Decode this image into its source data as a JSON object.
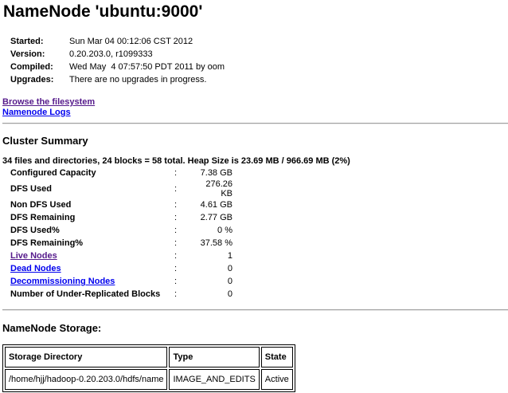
{
  "page": {
    "title": "NameNode 'ubuntu:9000'"
  },
  "info": [
    {
      "label": "Started:",
      "value": "Sun Mar 04 00:12:06 CST 2012"
    },
    {
      "label": "Version:",
      "value": "0.20.203.0, r1099333"
    },
    {
      "label": "Compiled:",
      "value": "Wed May  4 07:57:50 PDT 2011 by oom"
    },
    {
      "label": "Upgrades:",
      "value": "There are no upgrades in progress."
    }
  ],
  "links": {
    "browse": "Browse the filesystem",
    "logs": "Namenode Logs"
  },
  "cluster": {
    "heading": "Cluster Summary",
    "summary": "34 files and directories, 24 blocks = 58 total. Heap Size is 23.69 MB / 966.69 MB (2%)",
    "rows": [
      {
        "label": "Configured Capacity",
        "value": "7.38 GB"
      },
      {
        "label": "DFS Used",
        "value": "276.26 KB"
      },
      {
        "label": "Non DFS Used",
        "value": "4.61 GB"
      },
      {
        "label": "DFS Remaining",
        "value": "2.77 GB"
      },
      {
        "label": "DFS Used%",
        "value": "0 %"
      },
      {
        "label": "DFS Remaining%",
        "value": "37.58 %"
      },
      {
        "label": "Live Nodes",
        "value": "1"
      },
      {
        "label": "Dead Nodes",
        "value": "0"
      },
      {
        "label": "Decommissioning Nodes",
        "value": "0"
      },
      {
        "label": "Number of Under-Replicated Blocks",
        "value": "0"
      }
    ],
    "colon": ":"
  },
  "storage": {
    "heading": "NameNode Storage:",
    "headers": [
      "Storage Directory",
      "Type",
      "State"
    ],
    "rows": [
      [
        "/home/hjj/hadoop-0.20.203.0/hdfs/name",
        "IMAGE_AND_EDITS",
        "Active"
      ]
    ]
  },
  "colors": {
    "visited_link": "#551a8b",
    "link": "#0000ee"
  }
}
